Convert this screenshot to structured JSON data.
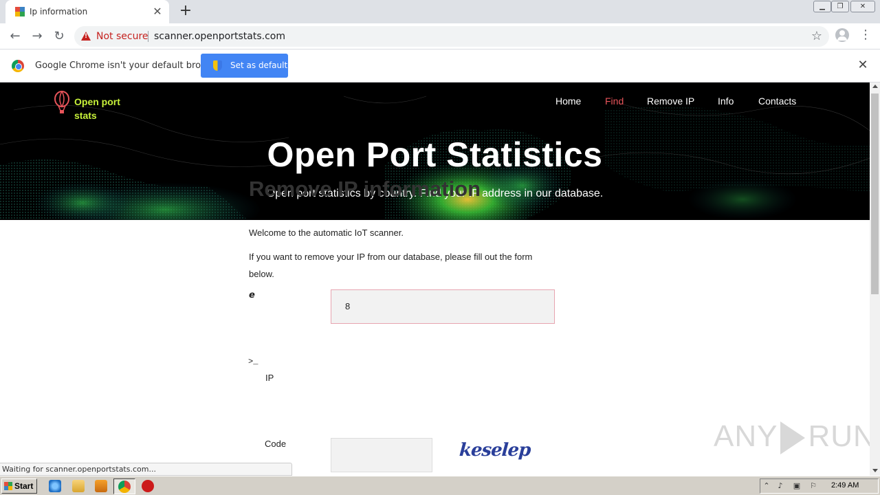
{
  "browser": {
    "tab_title": "Ip information",
    "tab_close": "✕",
    "new_tab": "+",
    "not_secure": "Not secure",
    "url": "scanner.openportstats.com",
    "window_minimize": "▁",
    "window_restore": "❐",
    "window_close": "✕"
  },
  "infobar": {
    "message": "Google Chrome isn't your default browser",
    "button_label": "Set as default",
    "close": "✕"
  },
  "site": {
    "logo_line1": "Open port",
    "logo_line2": "stats",
    "nav": [
      {
        "label": "Home",
        "active": false
      },
      {
        "label": "Find",
        "active": true
      },
      {
        "label": "Remove IP",
        "active": false
      },
      {
        "label": "Info",
        "active": false
      },
      {
        "label": "Contacts",
        "active": false
      }
    ],
    "hero_title": "Open Port Statistics",
    "hero_subtitle": "Open port statistics by country. Find your IP address in our database.",
    "accent_color": "#e8545a"
  },
  "content": {
    "heading": "Remove IP information",
    "para1": "Welcome to the automatic IoT scanner.",
    "para2": "If you want to remove your IP from our database, please fill out the form below.",
    "ip_label": "IP",
    "ip_value": "8",
    "code_label": "Code",
    "code_prompt": ">_",
    "code_value": "",
    "captcha_text": "keselep"
  },
  "status": {
    "text": "Waiting for scanner.openportstats.com..."
  },
  "watermark": {
    "left": "ANY",
    "right": "RUN"
  },
  "taskbar": {
    "start_label": "Start",
    "clock": "2:49 AM"
  }
}
